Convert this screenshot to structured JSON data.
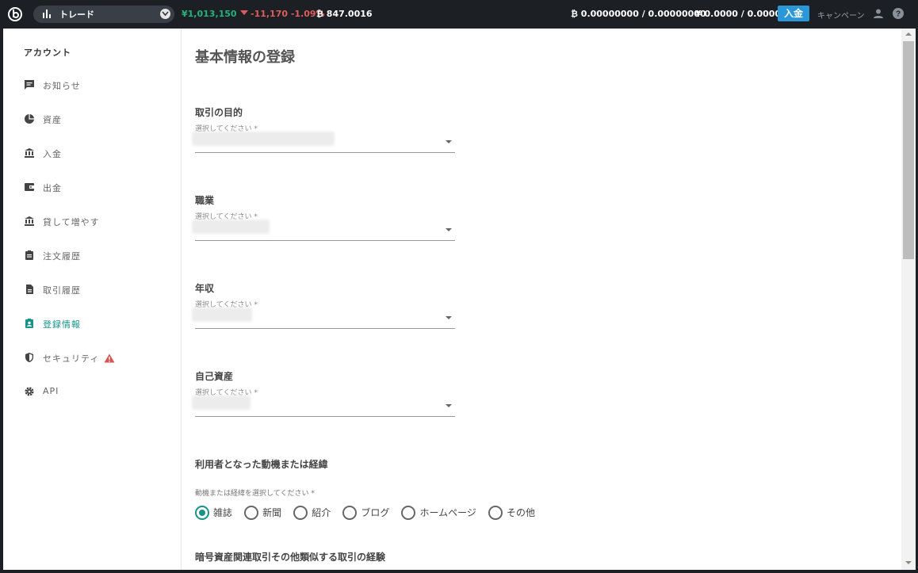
{
  "topbar": {
    "market_label": "トレード",
    "price_jpy": "¥1,013,150",
    "price_change": "-11,170 -1.09%",
    "price_btc": "847.0016",
    "balance_btc": "0.00000000 / 0.00000000",
    "balance_jpy": "¥ 0.0000 / 0.0000",
    "deposit_label": "入金",
    "campaign_label": "キャンペーン",
    "up_color": "#21b37d",
    "down_color": "#e05c5c",
    "accent": "#2a97d9"
  },
  "sidebar": {
    "header": "アカウント",
    "items": [
      {
        "label": "お知らせ",
        "icon": "message-icon"
      },
      {
        "label": "資産",
        "icon": "pie-chart-icon"
      },
      {
        "label": "入金",
        "icon": "bank-icon"
      },
      {
        "label": "出金",
        "icon": "wallet-icon"
      },
      {
        "label": "貸して増やす",
        "icon": "bank-icon"
      },
      {
        "label": "注文履歴",
        "icon": "clipboard-icon"
      },
      {
        "label": "取引履歴",
        "icon": "document-icon"
      },
      {
        "label": "登録情報",
        "icon": "account-box-icon",
        "active": true
      },
      {
        "label": "セキュリティ",
        "icon": "shield-icon",
        "warning": true
      },
      {
        "label": "API",
        "icon": "gear-icon"
      }
    ],
    "active_color": "#17938a"
  },
  "main": {
    "title": "基本情報の登録",
    "fields": [
      {
        "label": "取引の目的",
        "placeholder": "選択してください *"
      },
      {
        "label": "職業",
        "placeholder": "選択してください *"
      },
      {
        "label": "年収",
        "placeholder": "選択してください *"
      },
      {
        "label": "自己資産",
        "placeholder": "選択してください *"
      }
    ],
    "motivation": {
      "title": "利用者となった動機または経緯",
      "hint": "動機または経緯を選択してください *",
      "options": [
        "雑誌",
        "新聞",
        "紹介",
        "ブログ",
        "ホームページ",
        "その他"
      ],
      "selected": "雑誌"
    },
    "experience_title": "暗号資産関連取引その他類似する取引の経験"
  }
}
